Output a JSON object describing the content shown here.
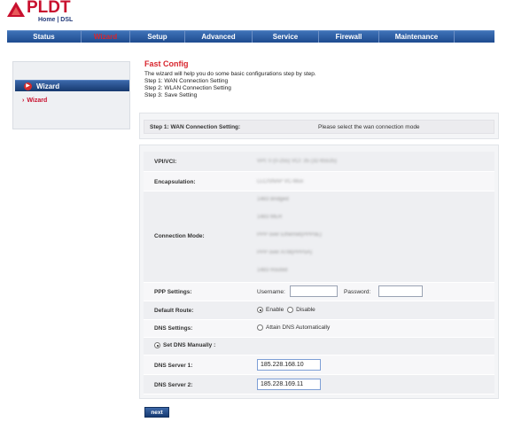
{
  "brand": {
    "name": "PLDT",
    "sub": "Home | DSL",
    "color": "#c8102e"
  },
  "nav": {
    "items": [
      {
        "label": "Status",
        "active": false
      },
      {
        "label": "Wizard",
        "active": true
      },
      {
        "label": "Setup",
        "active": false
      },
      {
        "label": "Advanced",
        "active": false
      },
      {
        "label": "Service",
        "active": false
      },
      {
        "label": "Firewall",
        "active": false
      },
      {
        "label": "Maintenance",
        "active": false
      }
    ]
  },
  "sidebar": {
    "header": "Wizard",
    "items": [
      {
        "label": "Wizard"
      }
    ]
  },
  "intro": {
    "title": "Fast Config",
    "lines": [
      "The wizard will help you do some basic configurations step by step.",
      "Step 1: WAN Connection Setting",
      "Step 2: WLAN Connection Setting",
      "Step 3: Save Setting"
    ]
  },
  "step": {
    "label": "Step 1: WAN Connection Setting:",
    "hint": "Please select the wan connection mode"
  },
  "form": {
    "vpi_label": "VPI/VCI:",
    "vpi_value": "VPI: 0   (0-255) VCI: 35   (32-65535)",
    "encap_label": "Encapsulation:",
    "encap_value": "LLC/SNAP  VC-Mux",
    "connmode_label": "Connection Mode:",
    "connmode_options": [
      "1483 Bridged",
      "1483 MER",
      "PPP over Ethernet(PPPoE)",
      "PPP over ATM(PPPoA)",
      "1483 Routed"
    ],
    "ppp_label": "PPP Settings:",
    "username_label": "Username:",
    "username_value": "",
    "password_label": "Password:",
    "password_value": "",
    "default_route_label": "Default Route:",
    "enable_label": "Enable",
    "disable_label": "Disable",
    "default_route_selected": "Enable",
    "dns_settings_label": "DNS Settings:",
    "attain_dns_label": "Attain DNS Automatically",
    "set_dns_label": "Set DNS Manually :",
    "dns1_label": "DNS Server 1:",
    "dns1_value": "185.228.168.10",
    "dns2_label": "DNS Server 2:",
    "dns2_value": "185.228.169.11"
  },
  "next_label": "next"
}
